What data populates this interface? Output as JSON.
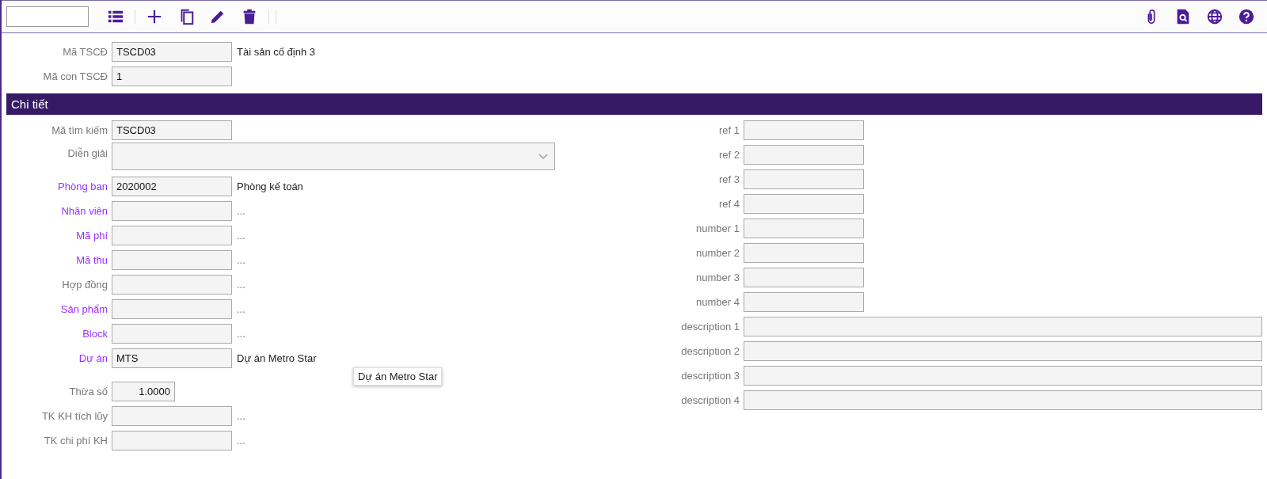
{
  "header_fields": [
    {
      "label": "Mã TSCĐ",
      "value": "TSCD03",
      "note": "Tài sản cố định 3"
    },
    {
      "label": "Mã con TSCĐ",
      "value": "1"
    }
  ],
  "section": {
    "title": "Chi tiết"
  },
  "left_fields": [
    {
      "label": "Mã tìm kiếm",
      "link": false,
      "kind": "text",
      "value": "TSCD03"
    },
    {
      "label": "Diễn giải",
      "link": false,
      "kind": "dropdown"
    },
    {
      "label": "Phòng ban",
      "link": true,
      "kind": "text",
      "value": "2020002",
      "note": "Phòng kế toán"
    },
    {
      "label": "Nhân viên",
      "link": true,
      "kind": "text",
      "note": "..."
    },
    {
      "label": "Mã phí",
      "link": true,
      "kind": "text",
      "note": "..."
    },
    {
      "label": "Mã thu",
      "link": true,
      "kind": "text",
      "note": "..."
    },
    {
      "label": "Hợp đồng",
      "link": false,
      "kind": "text",
      "note": "..."
    },
    {
      "label": "Sản phẩm",
      "link": true,
      "kind": "text",
      "note": "..."
    },
    {
      "label": "Block",
      "link": true,
      "kind": "text",
      "note": "..."
    },
    {
      "label": "Dự án",
      "link": true,
      "kind": "text",
      "value": "MTS",
      "note": "Dự án Metro Star"
    },
    {
      "label": "Thừa số",
      "link": false,
      "kind": "number",
      "value": "1.0000"
    },
    {
      "label": "TK KH tích lũy",
      "link": false,
      "kind": "text",
      "note": "..."
    },
    {
      "label": "TK chi phí KH",
      "link": false,
      "kind": "text",
      "note": "..."
    }
  ],
  "right_fields": [
    {
      "label": "ref 1",
      "kind": "text"
    },
    {
      "label": "ref 2",
      "kind": "text"
    },
    {
      "label": "ref 3",
      "kind": "text"
    },
    {
      "label": "ref 4",
      "kind": "text"
    },
    {
      "label": "number 1",
      "kind": "text"
    },
    {
      "label": "number 2",
      "kind": "text"
    },
    {
      "label": "number 3",
      "kind": "text"
    },
    {
      "label": "number 4",
      "kind": "text"
    },
    {
      "label": "description 1",
      "kind": "wide"
    },
    {
      "label": "description 2",
      "kind": "wide"
    },
    {
      "label": "description 3",
      "kind": "wide"
    },
    {
      "label": "description 4",
      "kind": "wide"
    }
  ],
  "tooltip": {
    "text": "Dự án Metro Star"
  }
}
